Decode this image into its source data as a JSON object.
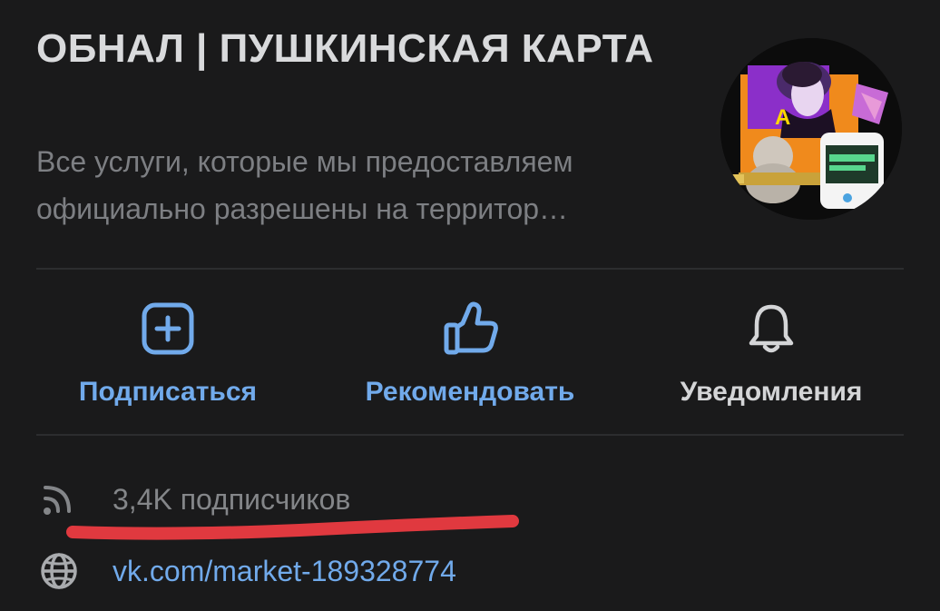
{
  "community": {
    "title": "ОБНАЛ | ПУШКИНСКАЯ КАРТА",
    "description": "Все услуги, которые мы предоставляем официально разрешены на территор…"
  },
  "actions": [
    {
      "label": "Подписаться",
      "icon": "plus-square-icon",
      "color": "#71aaeb"
    },
    {
      "label": "Рекомендовать",
      "icon": "thumbs-up-icon",
      "color": "#71aaeb"
    },
    {
      "label": "Уведомления",
      "icon": "bell-icon",
      "color": "#d4d5d7"
    }
  ],
  "info": {
    "subscribers": {
      "text": "3,4K подписчиков",
      "icon": "rss-icon"
    },
    "link": {
      "text": "vk.com/market-189328774",
      "icon": "globe-icon"
    }
  },
  "colors": {
    "background": "#1a1a1b",
    "accent": "#71aaeb",
    "annotation": "#e0393f"
  }
}
